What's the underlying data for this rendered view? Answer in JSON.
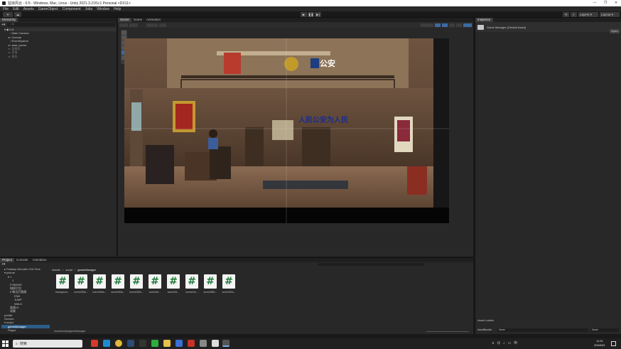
{
  "window": {
    "title": "监狱风云 - 0-5 - Windows, Mac, Linux - Unity 2021.3.21f1c1 Personal <DX11>",
    "minimize": "—",
    "maximize": "❐",
    "close": "✕"
  },
  "menu": [
    "File",
    "Edit",
    "Assets",
    "GameObject",
    "Component",
    "Jobs",
    "Window",
    "Help"
  ],
  "toolbar": {
    "account": "▾",
    "play": "▶",
    "pause": "❚❚",
    "step": "▶|",
    "layers": "Layers",
    "layout": "Layout"
  },
  "hierarchy": {
    "tab": "Hierarchy",
    "search_placeholder": "All",
    "items": [
      {
        "label": "0-5",
        "style": "root"
      },
      {
        "label": "Main Camera",
        "style": "normal"
      },
      {
        "label": "Canvas",
        "style": "normal"
      },
      {
        "label": "EventSystem",
        "style": "normal"
      },
      {
        "label": "start_scene",
        "style": "normal"
      },
      {
        "label": "背景声",
        "style": "dim"
      },
      {
        "label": "音效",
        "style": "dim"
      },
      {
        "label": "角色",
        "style": "dim"
      }
    ]
  },
  "scene": {
    "tabs": [
      "Scene",
      "Game",
      "Animation"
    ],
    "active_tab": "Scene",
    "sign_top": "公安",
    "banner": "人民公安为人民"
  },
  "inspector": {
    "tab": "Inspector",
    "object": "Game Manager (Default Asset)",
    "open": "Open",
    "asset_labels": "Asset Labels",
    "asset_bundle_label": "AssetBundle",
    "asset_bundle_value": "None",
    "asset_variant_value": "None"
  },
  "project": {
    "tabs": [
      "Project",
      "Console",
      "Animation"
    ],
    "active_tab": "Project",
    "breadcrumb": [
      "Assets",
      "script",
      "gameManager"
    ],
    "footer_path": "Assets/script/gameManager",
    "tree": [
      {
        "label": "Fantasy Wooden GUI Free",
        "style": "normal"
      },
      {
        "label": "picture",
        "style": "normal"
      },
      {
        "label": "1",
        "style": "normal"
      },
      {
        "label": "1",
        "style": "normal"
      },
      {
        "label": "FOBAND",
        "style": "normal"
      },
      {
        "label": "指挥打包",
        "style": "normal"
      },
      {
        "label": "拳击打跑跳",
        "style": "normal"
      },
      {
        "label": "END",
        "style": "normal"
      },
      {
        "label": "JUMP",
        "style": "normal"
      },
      {
        "label": "WALK",
        "style": "normal"
      },
      {
        "label": "道具UI",
        "style": "normal"
      },
      {
        "label": "场景",
        "style": "normal"
      },
      {
        "label": "prefab",
        "style": "normal"
      },
      {
        "label": "Scenes",
        "style": "normal"
      },
      {
        "label": "script",
        "style": "normal"
      },
      {
        "label": "gameManager",
        "style": "sel"
      },
      {
        "label": "Player",
        "style": "normal"
      }
    ],
    "files": [
      "backgroun...",
      "scene0Ma...",
      "scene0Ma...",
      "scene0Ma...",
      "scene0Ma...",
      "scene0d...",
      "scene0d...",
      "scene0m...",
      "scene0Bh...",
      "scene0Ea..."
    ]
  },
  "taskbar": {
    "search": "搜索",
    "time": "11:41",
    "date": "2024/5/1",
    "lang": "中"
  },
  "colors": {
    "accent": "#2c5d87",
    "script_icon": "#1e7a3a",
    "banner_text": "#1b2d8f"
  }
}
